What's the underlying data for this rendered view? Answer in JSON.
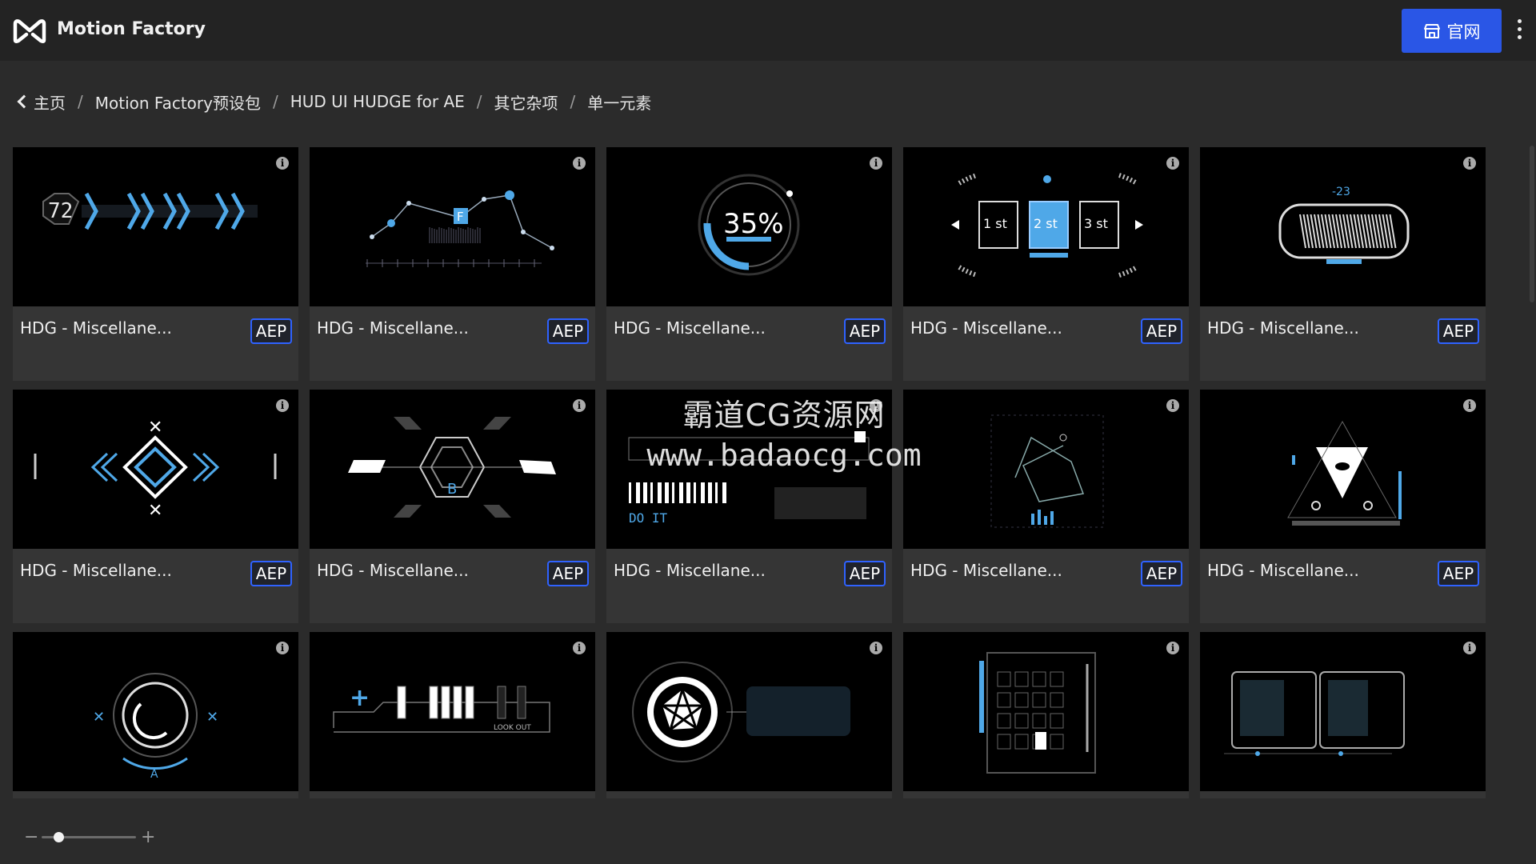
{
  "app": {
    "title": "Motion Factory"
  },
  "header": {
    "site_button_label": "官网"
  },
  "breadcrumb": {
    "items": [
      {
        "label": "主页"
      },
      {
        "label": "Motion Factory预设包"
      },
      {
        "label": "HUD UI HUDGE for AE"
      },
      {
        "label": "其它杂项"
      },
      {
        "label": "单一元素"
      }
    ],
    "separator": "/"
  },
  "cards": [
    {
      "title": "HDG - Miscellane...",
      "badge": "AEP",
      "thumb": "chevrons",
      "thumb_text": "72"
    },
    {
      "title": "HDG - Miscellane...",
      "badge": "AEP",
      "thumb": "graph",
      "thumb_text": "F"
    },
    {
      "title": "HDG - Miscellane...",
      "badge": "AEP",
      "thumb": "percent",
      "thumb_text": "35%"
    },
    {
      "title": "HDG - Miscellane...",
      "badge": "AEP",
      "thumb": "selector",
      "thumb_texts": [
        "1 st",
        "2 st",
        "3 st"
      ]
    },
    {
      "title": "HDG - Miscellane...",
      "badge": "AEP",
      "thumb": "barcode",
      "thumb_text": "-23"
    },
    {
      "title": "HDG - Miscellane...",
      "badge": "AEP",
      "thumb": "diamond",
      "thumb_text": ""
    },
    {
      "title": "HDG - Miscellane...",
      "badge": "AEP",
      "thumb": "hexagon",
      "thumb_text": "B"
    },
    {
      "title": "HDG - Miscellane...",
      "badge": "AEP",
      "thumb": "doit",
      "thumb_text": "DO IT"
    },
    {
      "title": "HDG - Miscellane...",
      "badge": "AEP",
      "thumb": "network",
      "thumb_text": ""
    },
    {
      "title": "HDG - Miscellane...",
      "badge": "AEP",
      "thumb": "triangle",
      "thumb_text": ""
    },
    {
      "title": "",
      "badge": "",
      "thumb": "reticle",
      "thumb_text": "A"
    },
    {
      "title": "",
      "badge": "",
      "thumb": "bars",
      "thumb_text": "LOOK OUT"
    },
    {
      "title": "",
      "badge": "",
      "thumb": "aperture",
      "thumb_text": ""
    },
    {
      "title": "",
      "badge": "",
      "thumb": "panel",
      "thumb_text": ""
    },
    {
      "title": "",
      "badge": "",
      "thumb": "frames",
      "thumb_text": ""
    }
  ],
  "zoom": {
    "level": 0.18
  },
  "watermark": {
    "line1": "霸道CG资源网",
    "line2": "www.badaocg.com"
  },
  "colors": {
    "accent": "#2a56e6",
    "badge_border": "#2f62ff",
    "hud": "#4fa8e8"
  }
}
